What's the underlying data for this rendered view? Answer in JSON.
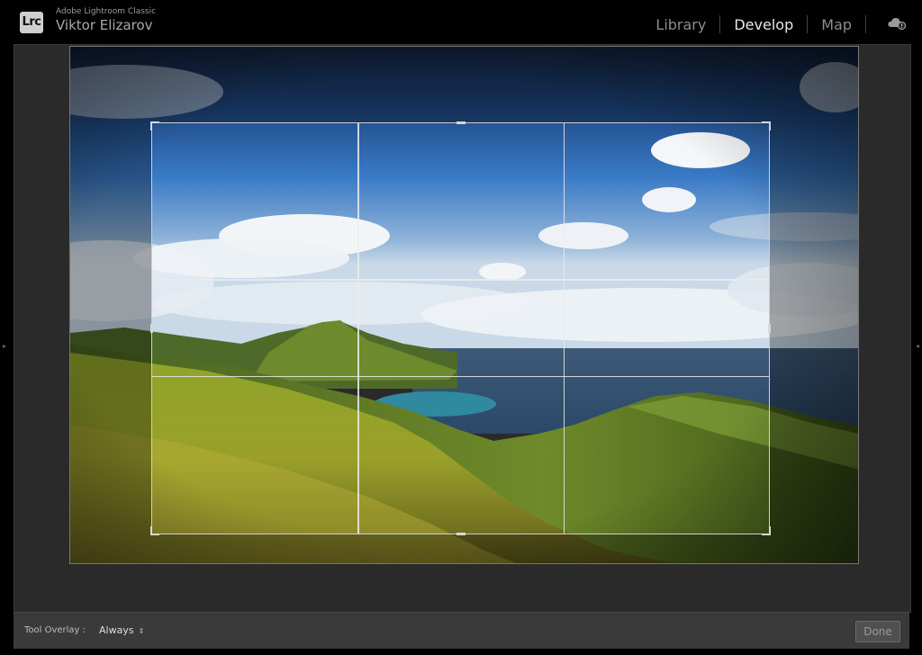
{
  "app": {
    "logo_text": "Lrc",
    "product_name": "Adobe Lightroom Classic",
    "user_name": "Viktor Elizarov"
  },
  "modules": [
    {
      "label": "Library",
      "active": false
    },
    {
      "label": "Develop",
      "active": true
    },
    {
      "label": "Map",
      "active": false
    }
  ],
  "toolbar": {
    "tool_overlay_label": "Tool Overlay :",
    "tool_overlay_value": "Always",
    "done_label": "Done"
  },
  "icons": {
    "logo": "lightroom-logo-icon",
    "cloud": "cloud-sync-icon",
    "left_panel_toggle": "left-panel-arrow-icon",
    "right_panel_toggle": "right-panel-arrow-icon",
    "select_arrows": "updown-arrows-icon"
  }
}
